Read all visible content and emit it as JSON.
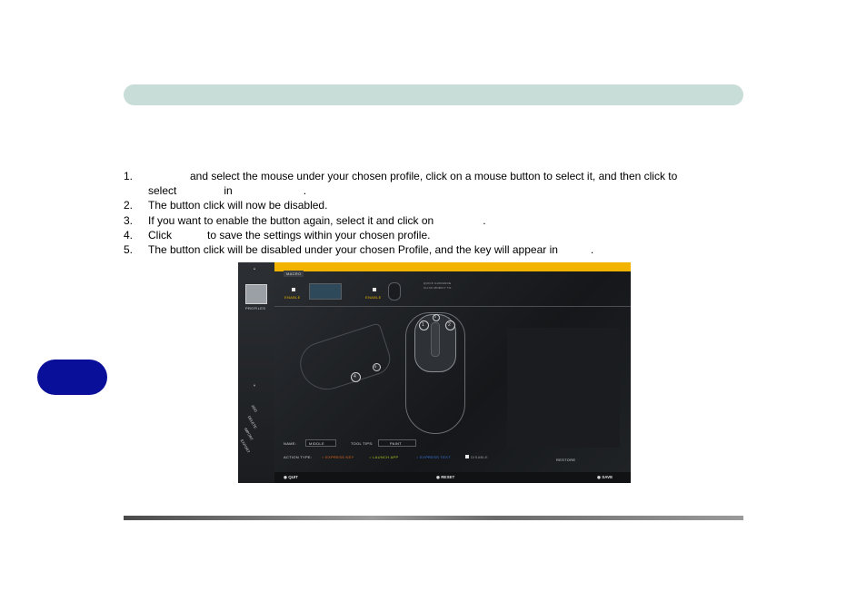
{
  "steps": [
    {
      "num": "1.",
      "part1": "and select the mouse under your chosen profile, click on a mouse button to select it, and then click to",
      "part2": "select",
      "part3": "in",
      "part4": "."
    },
    {
      "num": "2.",
      "text": "The button click will now be disabled."
    },
    {
      "num": "3.",
      "text": "If you want to enable the button again, select it and click on",
      "tail": "."
    },
    {
      "num": "4.",
      "part1": "Click",
      "part2": "to save the settings within your chosen profile."
    },
    {
      "num": "5.",
      "text": "The button click will be disabled under your chosen Profile, and the key will appear in",
      "tail": "."
    }
  ],
  "screenshot": {
    "tab_macro": "MACRO",
    "profiles_label": "PROFILES",
    "enable_1": "ENABLE",
    "enable_2": "ENABLE",
    "quick_guide": "QUICK GUIDANCE",
    "guide_line": "CLICK MODIFY TO",
    "side_menu": [
      "ADD",
      "DELETE",
      "IMPORT",
      "EXPORT"
    ],
    "name_label": "NAME:",
    "name_value": "MIDDLE",
    "tooltip_label": "TOOL TIPS:",
    "tooltip_value": "PAINT",
    "action_type_label": "ACTION TYPE:",
    "action_express_key": "EXPRESS KEY",
    "action_launch_app": "LAUNCH APP",
    "action_express_text": "EXPRESS TEXT",
    "action_disable": "DISABLE",
    "restore": "RESTORE",
    "quit": "QUIT",
    "reset": "RESET",
    "save": "SAVE",
    "button_numbers": [
      "1",
      "2",
      "3",
      "4",
      "5"
    ]
  }
}
